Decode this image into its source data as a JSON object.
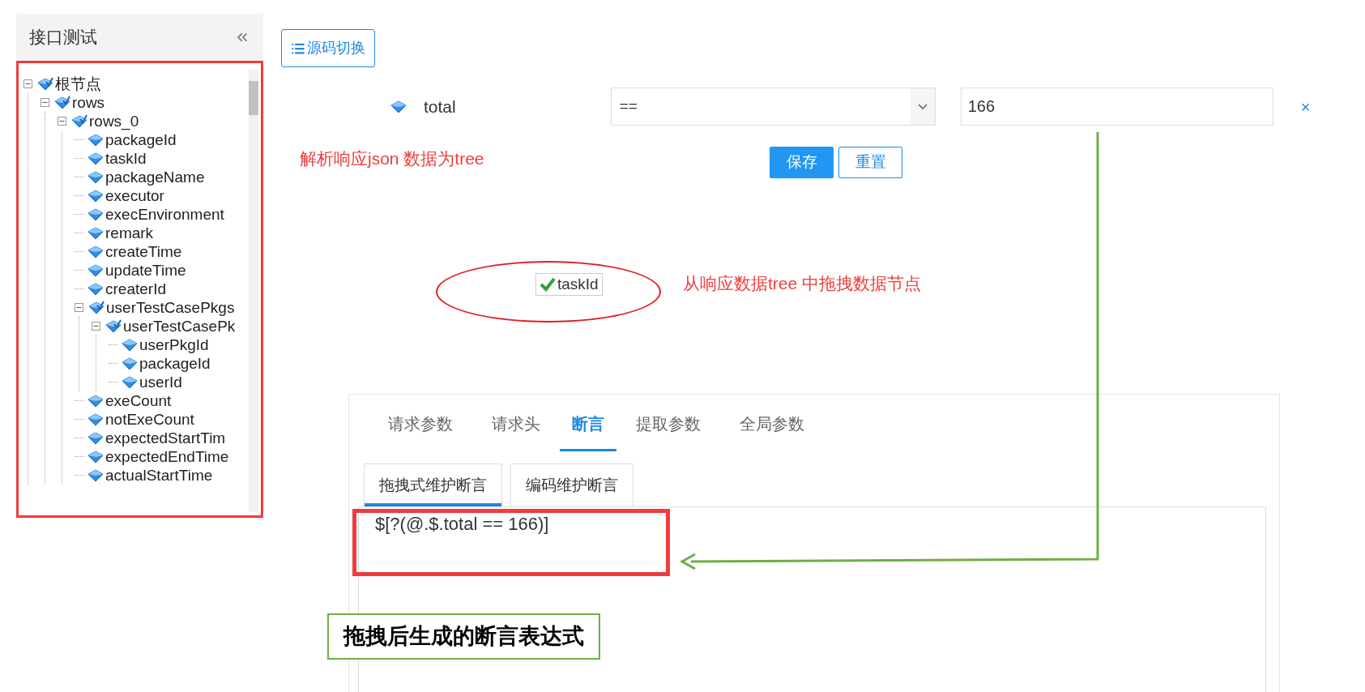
{
  "sidebar": {
    "title": "接口测试",
    "tree": [
      {
        "label": "根节点",
        "expanded": true,
        "children": [
          {
            "label": "rows",
            "expanded": true,
            "children": [
              {
                "label": "rows_0",
                "expanded": true,
                "children": [
                  {
                    "label": "packageId"
                  },
                  {
                    "label": "taskId"
                  },
                  {
                    "label": "packageName"
                  },
                  {
                    "label": "executor"
                  },
                  {
                    "label": "execEnvironment"
                  },
                  {
                    "label": "remark"
                  },
                  {
                    "label": "createTime"
                  },
                  {
                    "label": "updateTime"
                  },
                  {
                    "label": "createrId"
                  },
                  {
                    "label": "userTestCasePkgs",
                    "expanded": true,
                    "children": [
                      {
                        "label": "userTestCasePk",
                        "expanded": true,
                        "children": [
                          {
                            "label": "userPkgId"
                          },
                          {
                            "label": "packageId"
                          },
                          {
                            "label": "userId"
                          }
                        ]
                      }
                    ]
                  },
                  {
                    "label": "exeCount"
                  },
                  {
                    "label": "notExeCount"
                  },
                  {
                    "label": "expectedStartTim"
                  },
                  {
                    "label": "expectedEndTime"
                  },
                  {
                    "label": "actualStartTime"
                  }
                ]
              }
            ]
          }
        ]
      }
    ]
  },
  "toolbar": {
    "source_toggle": "源码切换"
  },
  "condition": {
    "field": "total",
    "operator": "==",
    "value": "166",
    "remove": "×"
  },
  "buttons": [
    {
      "label": "保存",
      "kind": "primary"
    },
    {
      "label": "重置",
      "kind": "default"
    }
  ],
  "drag_chip": {
    "label": "taskId"
  },
  "tabs": [
    {
      "label": "请求参数",
      "selected": false
    },
    {
      "label": "请求头",
      "selected": false
    },
    {
      "label": "断言",
      "selected": true
    },
    {
      "label": "提取参数",
      "selected": false
    },
    {
      "label": "全局参数",
      "selected": false
    }
  ],
  "subtabs": [
    {
      "label": "拖拽式维护断言",
      "selected": true
    },
    {
      "label": "编码维护断言",
      "selected": false
    }
  ],
  "editor": {
    "value": "$[?(@.$.total == 166)]"
  },
  "annotations": [
    {
      "kind": "note",
      "text": "解析响应json 数据为tree",
      "color": "#f03c3c"
    },
    {
      "kind": "note",
      "text": "从响应数据tree 中拖拽数据节点",
      "color": "#f03c3c"
    },
    {
      "kind": "callout",
      "text": "拖拽后生成的断言表达式",
      "color": "#70ad47"
    }
  ]
}
